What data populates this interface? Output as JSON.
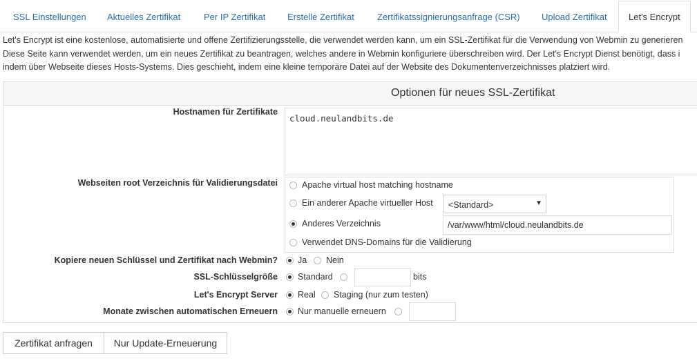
{
  "tabs": [
    {
      "label": "SSL Einstellungen"
    },
    {
      "label": "Aktuelles Zertifikat"
    },
    {
      "label": "Per IP Zertifikat"
    },
    {
      "label": "Erstelle Zertifikat"
    },
    {
      "label": "Zertifikatssignierungsanfrage (CSR)"
    },
    {
      "label": "Upload Zertifikat"
    },
    {
      "label": "Let's Encrypt"
    }
  ],
  "intro": [
    "Let's Encrypt ist eine kostenlose, automatisierte und offene Zertifizierungsstelle, die verwendet werden kann, um ein SSL-Zertifikat für die Verwendung von Webmin zu generieren",
    "Diese Seite kann verwendet werden, um ein neues Zertifikat zu beantragen, welches andere in Webmin konfiguriere überschreiben wird. Der Let's Encrypt Dienst benötigt, dass i",
    "indem über Webseite dieses Hosts-Systems. Dies geschieht, indem eine kleine temporäre Datei auf der Website des Dokumentenverzeichnisses platziert wird."
  ],
  "panel": {
    "title": "Optionen für neues SSL-Zertifikat",
    "hostnames": {
      "label": "Hostnamen für Zertifikate",
      "value": "cloud.neulandbits.de"
    },
    "webroot": {
      "label": "Webseiten root Verzeichnis für Validierungsdatei",
      "options": [
        "Apache virtual host matching hostname",
        "Ein anderer Apache virtueller Host",
        "Anderes Verzeichnis",
        "Verwendet DNS-Domains für die Validierung"
      ],
      "selected_index": 2,
      "vhost_select": "<Standard>",
      "dir_value": "/var/www/html/cloud.neulandbits.de"
    },
    "copy": {
      "label": "Kopiere neuen Schlüssel und Zertifikat nach Webmin?",
      "yes": "Ja",
      "no": "Nein",
      "selected": "Ja"
    },
    "keysize": {
      "label": "SSL-Schlüsselgröße",
      "default": "Standard",
      "unit": "bits",
      "selected": "Standard"
    },
    "server": {
      "label": "Let's Encrypt Server",
      "real": "Real",
      "staging": "Staging (nur zum testen)",
      "selected": "Real"
    },
    "renew": {
      "label": "Monate zwischen automatischen Erneuern",
      "manual": "Nur manuelle erneuern",
      "selected": "Nur manuelle erneuern"
    }
  },
  "buttons": {
    "request": "Zertifikat anfragen",
    "update": "Nur Update-Erneuerung"
  }
}
